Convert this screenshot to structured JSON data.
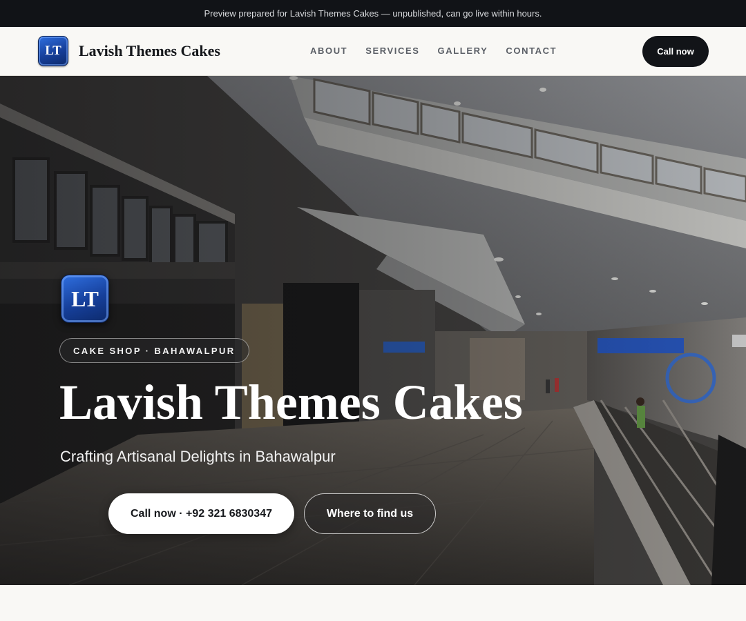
{
  "preview_bar": {
    "text": "Preview prepared for Lavish Themes Cakes — unpublished, can go live within hours."
  },
  "header": {
    "logo_initials": "LT",
    "brand_name": "Lavish Themes Cakes",
    "nav": [
      "ABOUT",
      "SERVICES",
      "GALLERY",
      "CONTACT"
    ],
    "cta_label": "Call now"
  },
  "hero": {
    "logo_initials": "LT",
    "tag": "CAKE SHOP · BAHAWALPUR",
    "title": "Lavish Themes Cakes",
    "subtitle": "Crafting Artisanal Delights in Bahawalpur",
    "primary_button": "Call now · +92 321 6830347",
    "secondary_button": "Where to find us",
    "background": "shopping-mall-interior-photo"
  },
  "colors": {
    "dark": "#121418",
    "logo_blue": "#163f9a",
    "page_bg": "#f9f8f5"
  }
}
